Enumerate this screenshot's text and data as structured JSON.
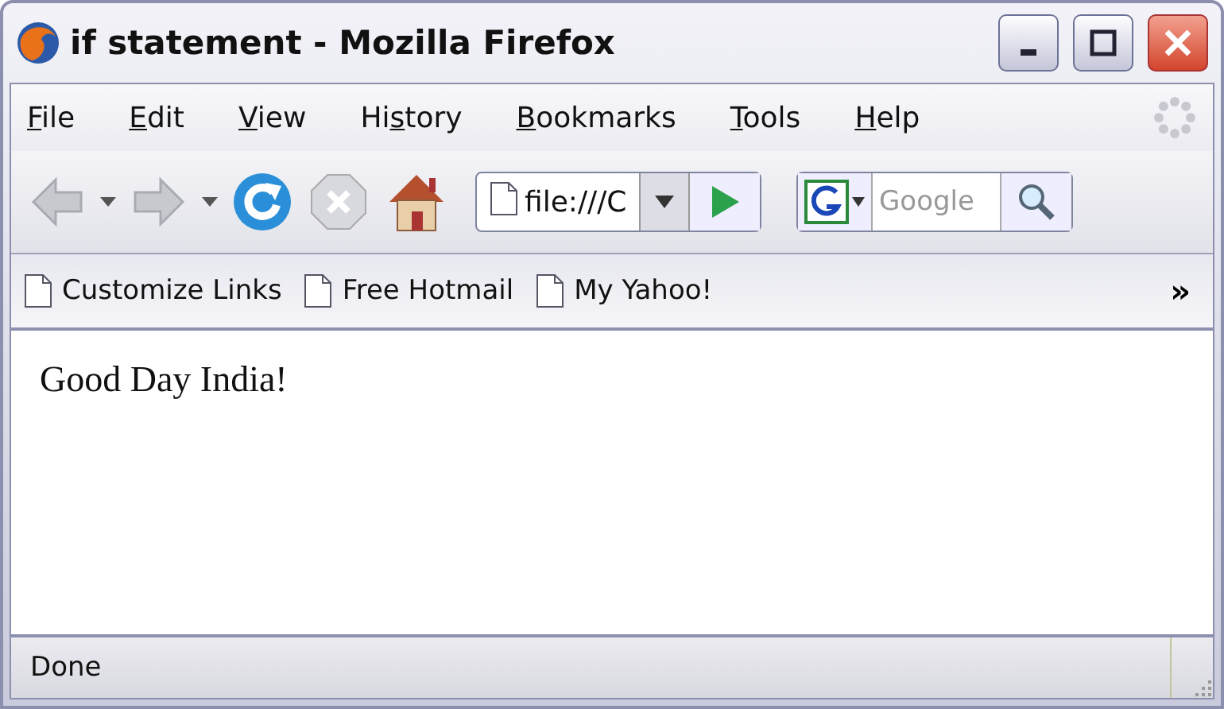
{
  "window": {
    "title": "if statement - Mozilla Firefox"
  },
  "menu": [
    {
      "key": "F",
      "post": "ile"
    },
    {
      "key": "E",
      "post": "dit"
    },
    {
      "key": "V",
      "post": "iew"
    },
    {
      "pre": "Hi",
      "key": "s",
      "post": "tory"
    },
    {
      "key": "B",
      "post": "ookmarks"
    },
    {
      "key": "T",
      "post": "ools"
    },
    {
      "key": "H",
      "post": "elp"
    }
  ],
  "navigation": {
    "back_disabled": true,
    "forward_disabled": true,
    "stop_disabled": true,
    "address": "file:///C",
    "search_placeholder": "Google"
  },
  "bookmarks": [
    "Customize Links",
    "Free Hotmail",
    "My Yahoo!"
  ],
  "bookmarks_overflow": "»",
  "content": {
    "text": "Good Day India!"
  },
  "status_bar": {
    "text": "Done"
  }
}
